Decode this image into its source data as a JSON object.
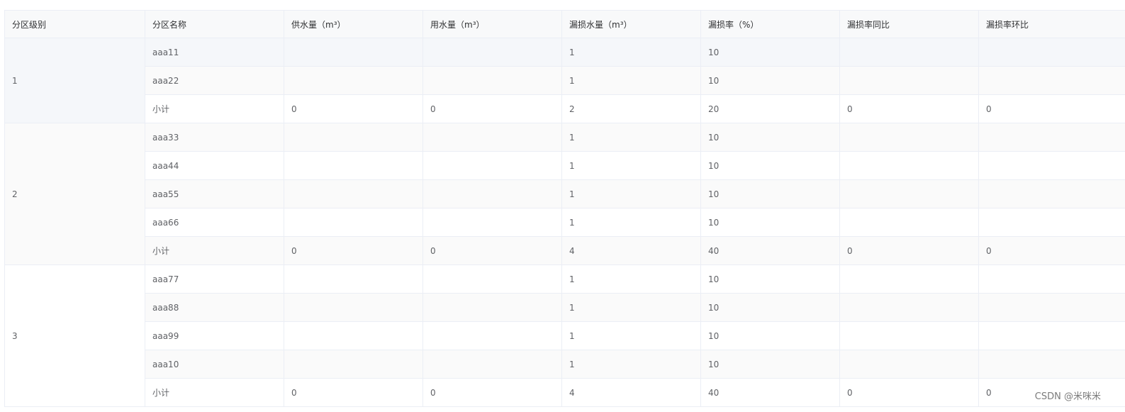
{
  "table": {
    "headers": [
      "分区级别",
      "分区名称",
      "供水量（m³）",
      "用水量（m³）",
      "漏损水量（m³）",
      "漏损率（%）",
      "漏损率同比",
      "漏损率环比"
    ],
    "groups": [
      {
        "level": "1",
        "rows": [
          {
            "name": "aaa11",
            "supply": "",
            "usage": "",
            "loss": "1",
            "rate": "10",
            "yoy": "",
            "mom": ""
          },
          {
            "name": "aaa22",
            "supply": "",
            "usage": "",
            "loss": "1",
            "rate": "10",
            "yoy": "",
            "mom": ""
          },
          {
            "name": "小计",
            "supply": "0",
            "usage": "0",
            "loss": "2",
            "rate": "20",
            "yoy": "0",
            "mom": "0"
          }
        ]
      },
      {
        "level": "2",
        "rows": [
          {
            "name": "aaa33",
            "supply": "",
            "usage": "",
            "loss": "1",
            "rate": "10",
            "yoy": "",
            "mom": ""
          },
          {
            "name": "aaa44",
            "supply": "",
            "usage": "",
            "loss": "1",
            "rate": "10",
            "yoy": "",
            "mom": ""
          },
          {
            "name": "aaa55",
            "supply": "",
            "usage": "",
            "loss": "1",
            "rate": "10",
            "yoy": "",
            "mom": ""
          },
          {
            "name": "aaa66",
            "supply": "",
            "usage": "",
            "loss": "1",
            "rate": "10",
            "yoy": "",
            "mom": ""
          },
          {
            "name": "小计",
            "supply": "0",
            "usage": "0",
            "loss": "4",
            "rate": "40",
            "yoy": "0",
            "mom": "0"
          }
        ]
      },
      {
        "level": "3",
        "rows": [
          {
            "name": "aaa77",
            "supply": "",
            "usage": "",
            "loss": "1",
            "rate": "10",
            "yoy": "",
            "mom": ""
          },
          {
            "name": "aaa88",
            "supply": "",
            "usage": "",
            "loss": "1",
            "rate": "10",
            "yoy": "",
            "mom": ""
          },
          {
            "name": "aaa99",
            "supply": "",
            "usage": "",
            "loss": "1",
            "rate": "10",
            "yoy": "",
            "mom": ""
          },
          {
            "name": "aaa10",
            "supply": "",
            "usage": "",
            "loss": "1",
            "rate": "10",
            "yoy": "",
            "mom": ""
          },
          {
            "name": "小计",
            "supply": "0",
            "usage": "0",
            "loss": "4",
            "rate": "40",
            "yoy": "0",
            "mom": "0"
          }
        ]
      }
    ]
  },
  "watermark": "CSDN @米咪米",
  "colors": {
    "header_bg": "#f8f9fa",
    "stripe_bg": "#fafafa",
    "hover_bg": "#f5f7fa",
    "border": "#ebeef5"
  }
}
